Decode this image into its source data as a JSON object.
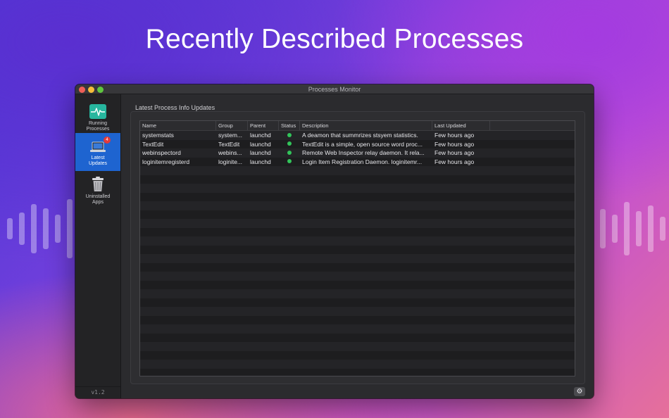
{
  "headline": "Recently Described Processes",
  "window": {
    "title": "Processes Monitor"
  },
  "sidebar": {
    "items": [
      {
        "label": "Running\nProcesses",
        "icon": "pulse-icon",
        "color": "#27b69e"
      },
      {
        "label": "Latest\nUpdates",
        "icon": "laptop-icon",
        "badge": "4",
        "selected": true
      },
      {
        "label": "Uninstalled\nApps",
        "icon": "trash-icon"
      }
    ],
    "version": "v1.2"
  },
  "main": {
    "section_title": "Latest Process Info Updates",
    "table": {
      "columns": [
        "Name",
        "Group",
        "Parent",
        "Status",
        "Description",
        "Last Updated"
      ],
      "rows": [
        {
          "name": "systemstats",
          "group": "system...",
          "parent": "launchd",
          "status": "green",
          "description": "A deamon that summrizes stsyem statistics.",
          "updated": "Few hours ago"
        },
        {
          "name": "TextEdit",
          "group": "TextEdit",
          "parent": "launchd",
          "status": "green",
          "description": "TextEdit is a simple, open source word proc...",
          "updated": "Few hours ago"
        },
        {
          "name": "webinspectord",
          "group": "webins...",
          "parent": "launchd",
          "status": "green",
          "description": "Remote Web Inspector relay daemon. It rela...",
          "updated": "Few hours ago"
        },
        {
          "name": "loginitemregisterd",
          "group": "loginite...",
          "parent": "launchd",
          "status": "green",
          "description": "Login Item Registration Daemon. loginitemr...",
          "updated": "Few hours ago"
        }
      ]
    }
  },
  "footer": {
    "settings_icon": "gear-icon"
  },
  "colors": {
    "accent": "#1e64d0",
    "status_green": "#32c45a",
    "badge": "#e23a3a"
  }
}
